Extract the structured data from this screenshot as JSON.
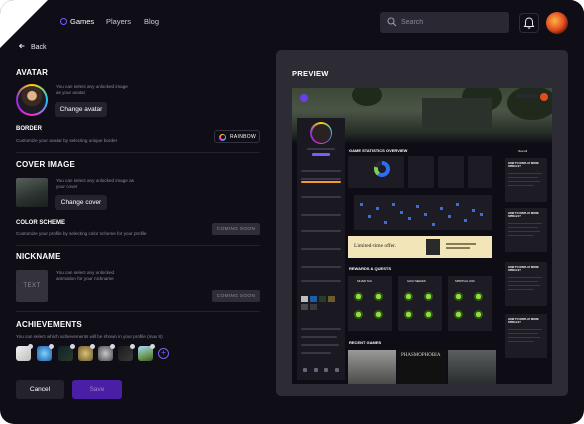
{
  "nav": {
    "links": [
      "Games",
      "Players",
      "Blog"
    ],
    "active": "Games",
    "search_placeholder": "Search"
  },
  "back_label": "Back",
  "avatar": {
    "title": "AVATAR",
    "hint": "You can select any unlocked image as your avatar",
    "button": "Change avatar"
  },
  "border": {
    "title": "BORDER",
    "desc": "Customize your avatar by selecting unique border",
    "button": "RAINBOW"
  },
  "cover": {
    "title": "COVER IMAGE",
    "hint": "You can select any unlocked image as your cover",
    "button": "Change cover"
  },
  "color_scheme": {
    "title": "COLOR SCHEME",
    "desc": "Customize your profile by selecting color scheme for your profile",
    "button": "COMING SOON"
  },
  "nickname": {
    "title": "NICKNAME",
    "thumb": "TEXT",
    "hint": "You can select any unlocked animation for your nickname",
    "button": "COMING SOON"
  },
  "achievements": {
    "title": "ACHIEVEMENTS",
    "desc": "You can select which achievements will be shown in your profile (max 8)",
    "items": [
      "thumb-badge-icon",
      "blue-wave-badge-icon",
      "cowboy-badge-icon",
      "gold-frame-badge-icon",
      "robot-badge-icon",
      "black-bottle-badge-icon",
      "green-landscape-badge-icon"
    ]
  },
  "actions": {
    "cancel": "Cancel",
    "save": "Save"
  },
  "preview": {
    "title": "PREVIEW",
    "stats_title": "GAME STATISTICS OVERVIEW",
    "promo": "Limited-time offer.",
    "rewards_title": "REWARDS & QUESTS",
    "view_all": "View All",
    "recent_title": "RECENT GAMES",
    "recent_game": "PHASMOPHOBIA",
    "quests": [
      "SILVER TAG",
      "GOLD SEEKER",
      "SPIRITUAL LINK"
    ],
    "guide_title": "HOW TO DISPLAY MORE SPIRALS?"
  },
  "colors": {
    "accent": "#7b5cff",
    "background": "#0f0d16",
    "panel": "#2d2b34",
    "save_bg": "#4a1fa6"
  }
}
